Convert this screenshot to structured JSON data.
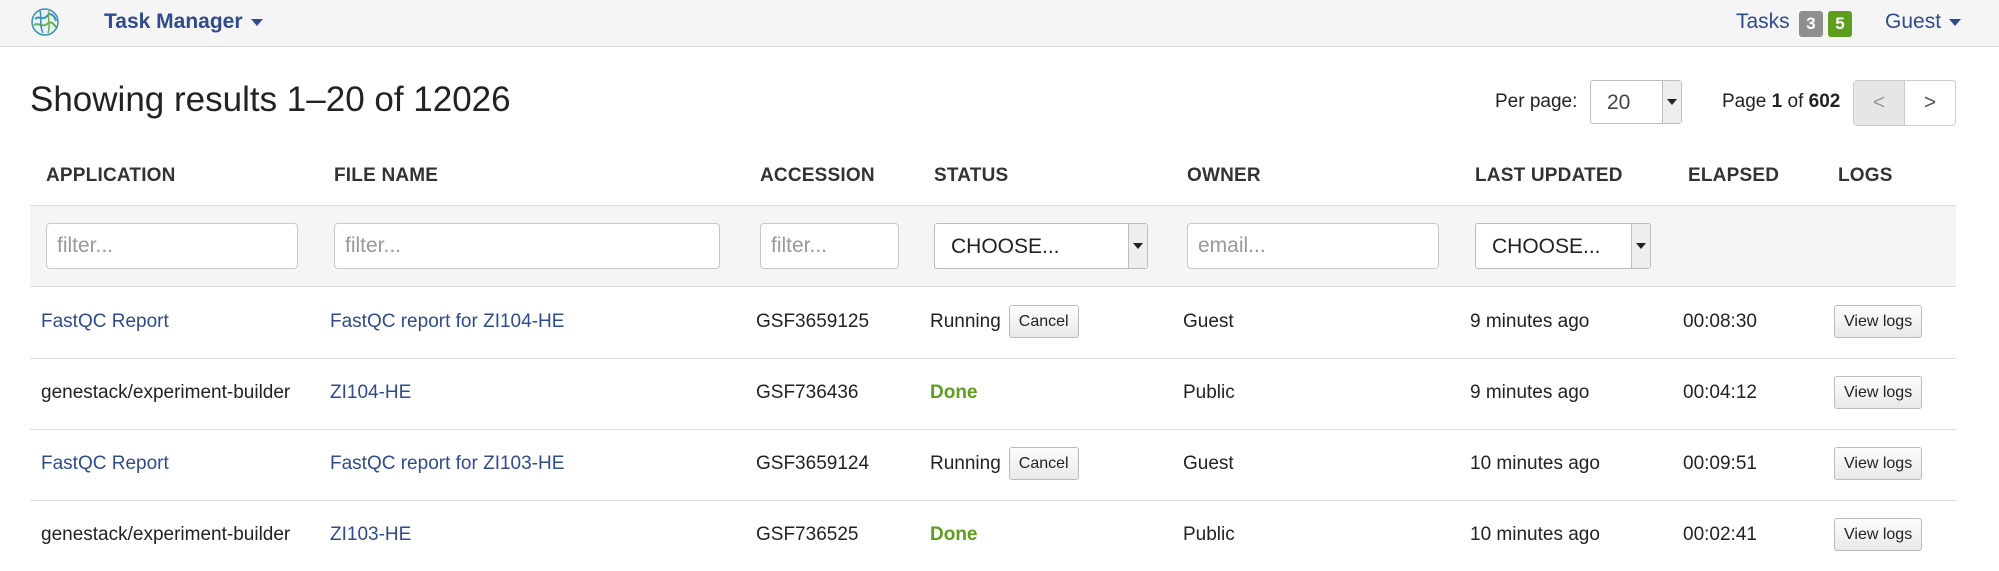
{
  "navbar": {
    "brand": "Task Manager",
    "tasks_label": "Tasks",
    "badge_grey": "3",
    "badge_green": "5",
    "user": "Guest"
  },
  "header": {
    "results_text": "Showing results 1–20 of 12026",
    "per_page_label": "Per page:",
    "per_page_value": "20",
    "page_prefix": "Page",
    "page_current": "1",
    "page_of": "of",
    "page_total": "602",
    "prev_label": "<",
    "next_label": ">"
  },
  "columns": [
    "APPLICATION",
    "FILE NAME",
    "ACCESSION",
    "STATUS",
    "OWNER",
    "LAST UPDATED",
    "ELAPSED",
    "LOGS"
  ],
  "filters": {
    "application_placeholder": "filter...",
    "filename_placeholder": "filter...",
    "accession_placeholder": "filter...",
    "status_value": "CHOOSE...",
    "owner_placeholder": "email...",
    "updated_value": "CHOOSE..."
  },
  "rows": [
    {
      "application": "FastQC Report",
      "file_name": "FastQC report for ZI104-HE",
      "accession": "GSF3659125",
      "status": "Running",
      "cancel": "Cancel",
      "owner": "Guest",
      "last_updated": "9 minutes ago",
      "elapsed": "00:08:30",
      "logs": "View logs"
    },
    {
      "application": "genestack/experiment-builder",
      "file_name": "ZI104-HE",
      "accession": "GSF736436",
      "status": "Done",
      "owner": "Public",
      "last_updated": "9 minutes ago",
      "elapsed": "00:04:12",
      "logs": "View logs"
    },
    {
      "application": "FastQC Report",
      "file_name": "FastQC report for ZI103-HE",
      "accession": "GSF3659124",
      "status": "Running",
      "cancel": "Cancel",
      "owner": "Guest",
      "last_updated": "10 minutes ago",
      "elapsed": "00:09:51",
      "logs": "View logs"
    },
    {
      "application": "genestack/experiment-builder",
      "file_name": "ZI103-HE",
      "accession": "GSF736525",
      "status": "Done",
      "owner": "Public",
      "last_updated": "10 minutes ago",
      "elapsed": "00:02:41",
      "logs": "View logs"
    }
  ],
  "colors": {
    "link": "#2f4b8c",
    "done": "#5e9e1f",
    "badge_grey": "#8f8f8f",
    "badge_green": "#5e9e1f"
  },
  "icons": {
    "logo": "globe-logo-icon",
    "dropdown": "caret-down-icon"
  }
}
